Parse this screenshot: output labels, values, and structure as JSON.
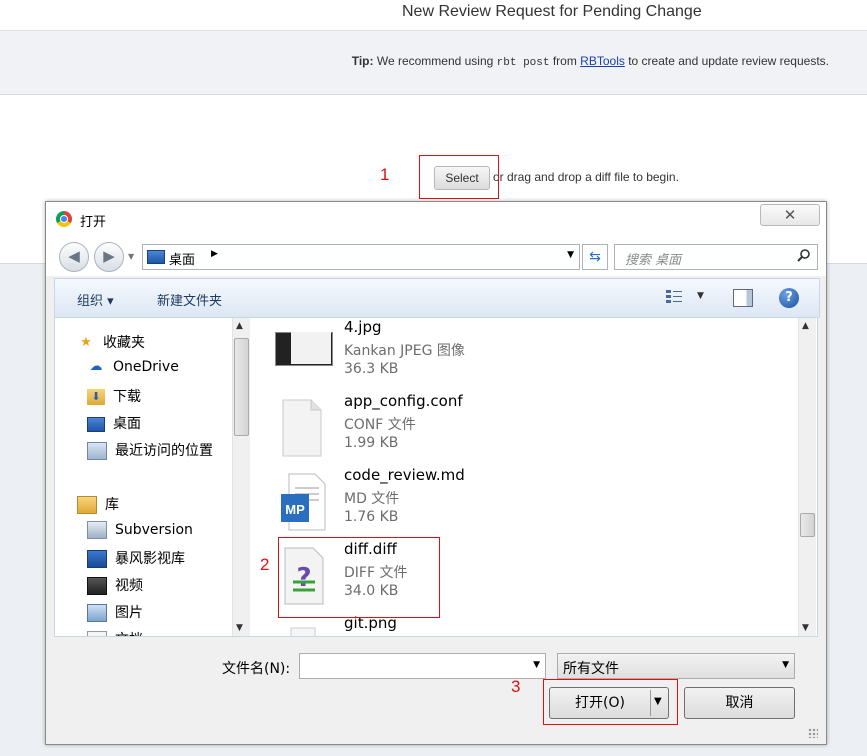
{
  "page": {
    "title": "New Review Request for Pending Change",
    "tip": {
      "label": "Tip:",
      "prefix": "We recommend using",
      "command": "rbt post",
      "middle": "from",
      "link": "RBTools",
      "suffix": "to create and update review requests."
    },
    "select_button": "Select",
    "drop_text": "or drag and drop a diff file to begin."
  },
  "annotations": {
    "one": "1",
    "two": "2",
    "three": "3",
    "color": "#dd1111"
  },
  "dialog": {
    "title": "打开",
    "close_icon": "✕",
    "address": {
      "location": "桌面",
      "arrow": "▶"
    },
    "search": {
      "placeholder": "搜索 桌面"
    },
    "toolbar": {
      "organize": "组织 ▾",
      "new_folder": "新建文件夹"
    },
    "nav_items": [
      {
        "label": "收藏夹",
        "icon": "star-icon"
      },
      {
        "label": "OneDrive",
        "icon": "cloud-icon"
      },
      {
        "label": "下载",
        "icon": "download-folder-icon"
      },
      {
        "label": "桌面",
        "icon": "desktop-icon"
      },
      {
        "label": "最近访问的位置",
        "icon": "recent-places-icon"
      },
      {
        "label": "库",
        "icon": "library-icon"
      },
      {
        "label": "Subversion",
        "icon": "subversion-icon"
      },
      {
        "label": "暴风影视库",
        "icon": "video-library-icon"
      },
      {
        "label": "视频",
        "icon": "video-icon"
      },
      {
        "label": "图片",
        "icon": "pictures-icon"
      },
      {
        "label": "文档",
        "icon": "documents-icon"
      }
    ],
    "files": [
      {
        "name": "4.jpg",
        "type": "Kankan JPEG 图像",
        "size": "36.3 KB",
        "icon": "image-thumbnail-icon"
      },
      {
        "name": "app_config.conf",
        "type": "CONF 文件",
        "size": "1.99 KB",
        "icon": "blank-file-icon"
      },
      {
        "name": "code_review.md",
        "type": "MD 文件",
        "size": "1.76 KB",
        "icon": "markdown-file-icon"
      },
      {
        "name": "diff.diff",
        "type": "DIFF 文件",
        "size": "34.0 KB",
        "icon": "diff-file-icon"
      },
      {
        "name": "git.png",
        "type": "",
        "size": "",
        "icon": "png-file-icon"
      }
    ],
    "filename_label": "文件名(N):",
    "filename_value": "",
    "filetype": "所有文件",
    "open_button": "打开(O)",
    "cancel_button": "取消"
  }
}
